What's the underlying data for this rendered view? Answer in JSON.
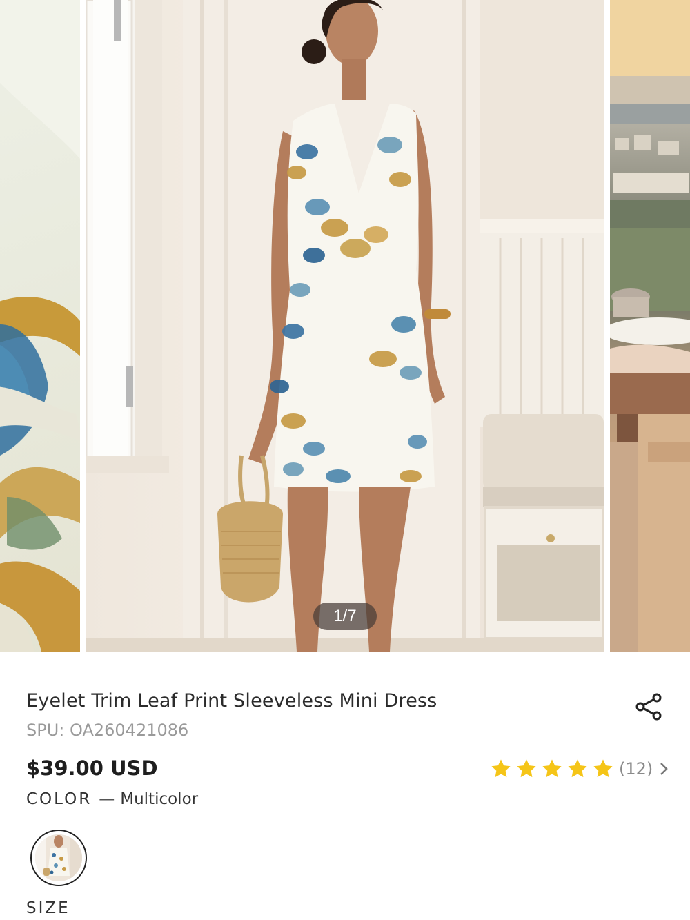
{
  "gallery": {
    "counter": "1/7",
    "slides": [
      "fabric-closeup",
      "model-in-dress",
      "model-outdoor"
    ]
  },
  "product": {
    "title": "Eyelet Trim Leaf Print Sleeveless Mini Dress",
    "spu": "SPU: OA260421086",
    "price": "$39.00 USD",
    "rating": {
      "stars": 5,
      "count_label": "(12)"
    }
  },
  "color": {
    "label": "COLOR",
    "dash": "—",
    "value": "Multicolor"
  },
  "size": {
    "label": "SIZE"
  },
  "colors": {
    "star": "#F5C518",
    "text": "#2b2b2b",
    "muted": "#9a9a9a"
  },
  "icons": {
    "share": "share-icon",
    "star": "star-icon",
    "chevron": "chevron-right-icon"
  }
}
